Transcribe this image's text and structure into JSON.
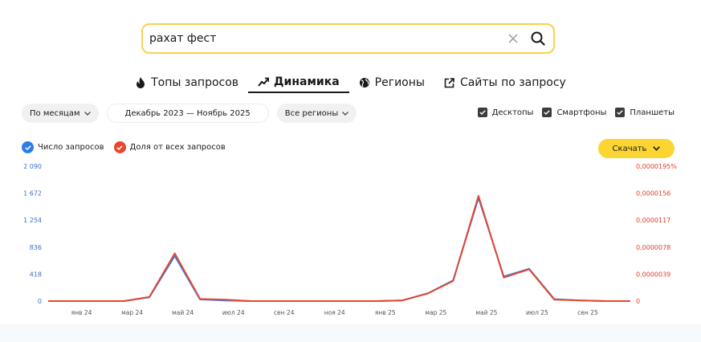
{
  "search": {
    "value": "рахат фест"
  },
  "tabs": [
    {
      "label": "Топы запросов",
      "icon": "flame-icon"
    },
    {
      "label": "Динамика",
      "icon": "trend-icon",
      "active": true
    },
    {
      "label": "Регионы",
      "icon": "globe-icon"
    },
    {
      "label": "Сайты по запросу",
      "icon": "external-link-icon"
    }
  ],
  "filters": {
    "period": "По месяцам",
    "date_range": "Декабрь 2023 — Ноябрь 2025",
    "regions": "Все регионы"
  },
  "devices": [
    {
      "label": "Десктопы",
      "checked": true
    },
    {
      "label": "Смартфоны",
      "checked": true
    },
    {
      "label": "Планшеты",
      "checked": true
    }
  ],
  "legend": [
    {
      "label": "Число запросов",
      "color": "#2b7de9"
    },
    {
      "label": "Доля от всех запросов",
      "color": "#e5472f"
    }
  ],
  "download_label": "Скачать",
  "colors": {
    "accent": "#fcd533",
    "count": "#2b7de9",
    "share": "#e5472f"
  },
  "chart_data": {
    "type": "line",
    "y_left_ticks": [
      "0",
      "418",
      "836",
      "1 254",
      "1 672",
      "2 090"
    ],
    "y_right_ticks": [
      "0",
      "0,0000039",
      "0,0000078",
      "0,0000117",
      "0,0000156",
      "0,0000195%"
    ],
    "x_ticks": [
      "янв 24",
      "мар 24",
      "май 24",
      "июл 24",
      "сен 24",
      "ноя 24",
      "янв 25",
      "мар 25",
      "май 25",
      "июл 25",
      "сен 25"
    ],
    "x": [
      "дек 23",
      "янв 24",
      "фев 24",
      "мар 24",
      "апр 24",
      "май 24",
      "июн 24",
      "июл 24",
      "авг 24",
      "сен 24",
      "окт 24",
      "ноя 24",
      "дек 24",
      "янв 25",
      "фев 25",
      "мар 25",
      "апр 25",
      "май 25",
      "июн 25",
      "июл 25",
      "авг 25",
      "сен 25",
      "окт 25",
      "ноя 25"
    ],
    "series": [
      {
        "name": "Число запросов",
        "axis": "left",
        "values": [
          0,
          0,
          0,
          0,
          60,
          700,
          25,
          10,
          0,
          0,
          0,
          0,
          0,
          0,
          10,
          120,
          320,
          1600,
          380,
          500,
          30,
          10,
          0,
          0
        ]
      },
      {
        "name": "Доля от всех запросов",
        "axis": "right",
        "values": [
          0,
          0,
          0,
          0,
          6e-07,
          6.9e-06,
          3e-07,
          2e-07,
          0,
          0,
          0,
          0,
          0,
          0,
          1e-07,
          1.1e-06,
          2.9e-06,
          1.52e-05,
          3.4e-06,
          4.6e-06,
          2e-07,
          1e-07,
          0,
          0
        ]
      }
    ],
    "ylim_left": [
      0,
      2090
    ],
    "ylim_right": [
      0,
      1.95e-05
    ],
    "grid": false
  }
}
